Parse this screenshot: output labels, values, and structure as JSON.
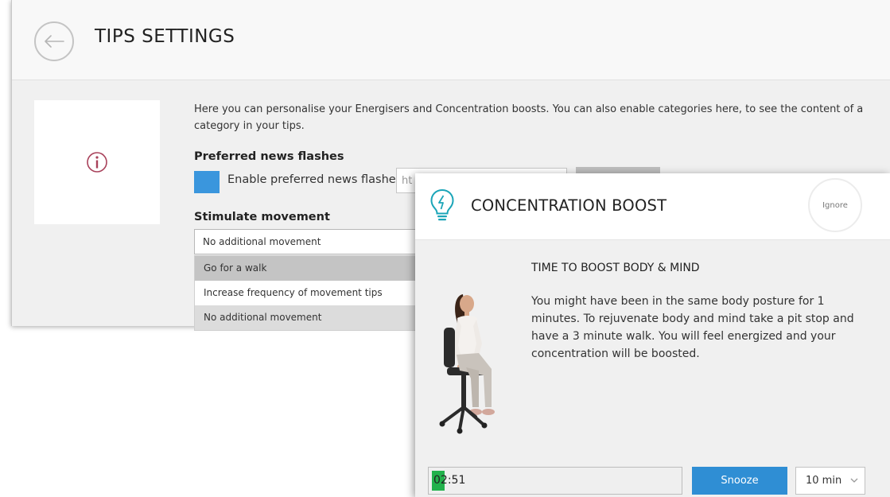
{
  "settings": {
    "title": "TIPS SETTINGS",
    "intro": "Here you can personalise your Energisers and Concentration boosts. You can also enable categories here, to see the content of a category in your tips.",
    "news": {
      "section_label": "Preferred news flashes",
      "checkbox_label": "Enable preferred news flashes",
      "input_value": "ht",
      "checked": true
    },
    "movement": {
      "section_label": "Stimulate movement",
      "selected": "No additional movement",
      "options": [
        "Go for a walk",
        "Increase frequency of movement tips",
        "No additional movement"
      ]
    },
    "accent": "#3a96dd"
  },
  "popup": {
    "title": "CONCENTRATION BOOST",
    "ignore_label": "Ignore",
    "heading": "TIME TO BOOST BODY & MIND",
    "body": "You might have been in the same body posture for 1 minutes. To rejuvenate body and mind take a pit stop and have a 3 minute walk. You will feel energized and your concentration will be boosted.",
    "timer": "02:51",
    "timer_progress_percent": 5,
    "snooze_label": "Snooze",
    "snooze_duration": "10 min",
    "icons": [
      "lightbulb-icon",
      "chevron-down-icon"
    ],
    "colors": {
      "snooze": "#2f8ed4",
      "progress": "#22b14c",
      "icon": "#1ba5b8"
    }
  }
}
